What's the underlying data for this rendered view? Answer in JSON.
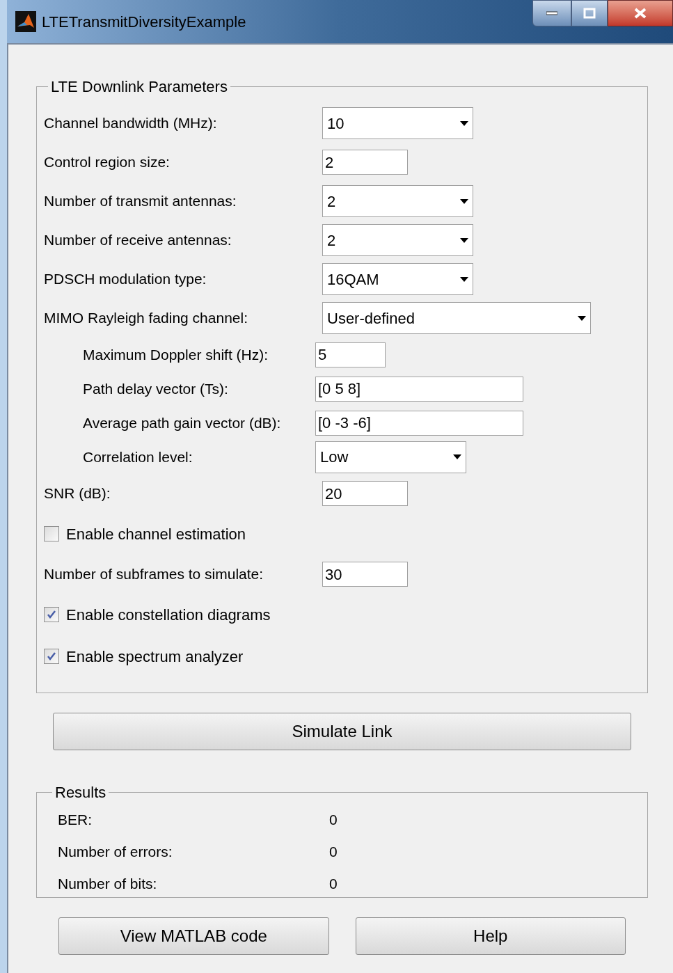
{
  "window": {
    "title": "LTETransmitDiversityExample"
  },
  "parameters": {
    "title": "LTE Downlink Parameters",
    "items": [
      {
        "kind": "select",
        "label": "Channel bandwidth (MHz):",
        "value": "10"
      },
      {
        "kind": "field",
        "label": "Control region size:",
        "value": "2"
      },
      {
        "kind": "select",
        "label": "Number of transmit antennas:",
        "value": "2"
      },
      {
        "kind": "select",
        "label": "Number of receive antennas:",
        "value": "2"
      },
      {
        "kind": "select",
        "label": "PDSCH modulation type:",
        "value": "16QAM"
      },
      {
        "kind": "select",
        "label": "MIMO Rayleigh fading channel:",
        "value": "User-defined",
        "children": [
          {
            "kind": "field",
            "label": "Maximum Doppler shift (Hz):",
            "value": "5"
          },
          {
            "kind": "field",
            "label": "Path delay vector (Ts):",
            "value": "[0 5 8]"
          },
          {
            "kind": "field",
            "label": "Average path gain vector (dB):",
            "value": "[0 -3 -6]"
          },
          {
            "kind": "select",
            "label": "Correlation level:",
            "value": "Low"
          }
        ]
      },
      {
        "kind": "field",
        "label": "SNR (dB):",
        "value": "20"
      },
      {
        "kind": "checkbox",
        "label": "Enable channel estimation",
        "checked": false
      },
      {
        "kind": "field",
        "label": "Number of subframes to simulate:",
        "value": "30"
      },
      {
        "kind": "checkbox",
        "label": "Enable constellation diagrams",
        "checked": true
      },
      {
        "kind": "checkbox",
        "label": "Enable spectrum analyzer",
        "checked": true
      }
    ]
  },
  "simulate_button": "Simulate Link",
  "results": {
    "title": "Results",
    "rows": [
      {
        "label": "BER:",
        "value": "0"
      },
      {
        "label": "Number of errors:",
        "value": "0"
      },
      {
        "label": "Number of bits:",
        "value": "0"
      }
    ]
  },
  "buttons": [
    "View MATLAB code",
    "Help"
  ]
}
